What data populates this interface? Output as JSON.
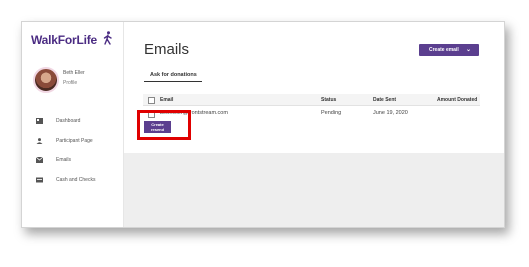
{
  "brand": {
    "walk": "WalkFor",
    "life": "Life"
  },
  "user": {
    "name": "Beth Eller",
    "profile_link": "Profile"
  },
  "nav": [
    {
      "label": "Dashboard",
      "icon": "dashboard-icon"
    },
    {
      "label": "Participant Page",
      "icon": "person-icon"
    },
    {
      "label": "Emails",
      "icon": "envelope-icon"
    },
    {
      "label": "Cash and Checks",
      "icon": "cash-icon"
    }
  ],
  "page": {
    "title": "Emails",
    "create_email_label": "Create email",
    "tab_label": "Ask for donations"
  },
  "table": {
    "headers": [
      "Email",
      "Status",
      "Date Sent",
      "Amount Donated"
    ],
    "rows": [
      {
        "email": "beth.eller@frontstream.com",
        "status": "Pending",
        "date_sent": "June 19, 2020",
        "amount": ""
      }
    ]
  },
  "resend_button": {
    "line1": "Create",
    "line2": "resend"
  },
  "colors": {
    "brand_purple": "#5b3f8f",
    "highlight_red": "#e00000"
  }
}
